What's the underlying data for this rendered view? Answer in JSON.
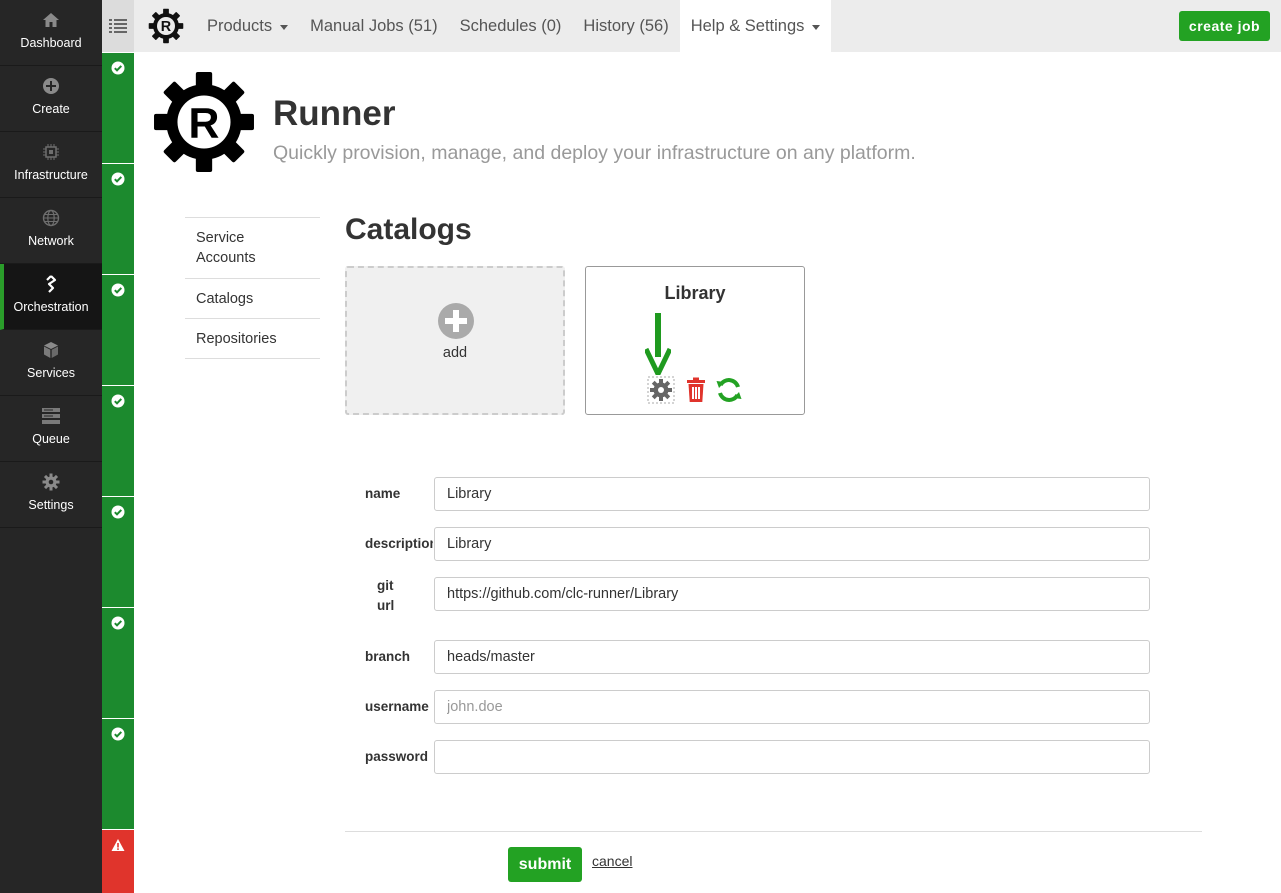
{
  "leftnav": {
    "items": [
      {
        "label": "Dashboard",
        "icon": "home-icon"
      },
      {
        "label": "Create",
        "icon": "plus-circle-icon"
      },
      {
        "label": "Infrastructure",
        "icon": "chip-icon"
      },
      {
        "label": "Network",
        "icon": "globe-icon"
      },
      {
        "label": "Orchestration",
        "icon": "orchestration-icon"
      },
      {
        "label": "Services",
        "icon": "cube-icon"
      },
      {
        "label": "Queue",
        "icon": "queue-icon"
      },
      {
        "label": "Settings",
        "icon": "gear-icon"
      }
    ],
    "active": "Orchestration"
  },
  "status": {
    "colors": {
      "ok": "#1c8a2e",
      "error": "#e0342c"
    },
    "cells": [
      "success",
      "success",
      "success",
      "success",
      "success",
      "success",
      "success",
      "error"
    ]
  },
  "topbar": {
    "menu": [
      {
        "label": "Products",
        "dropdown": true
      },
      {
        "label": "Manual Jobs (51)",
        "dropdown": false
      },
      {
        "label": "Schedules (0)",
        "dropdown": false
      },
      {
        "label": "History (56)",
        "dropdown": false
      },
      {
        "label": "Help & Settings",
        "dropdown": true
      }
    ],
    "create_job": "create job"
  },
  "header": {
    "title": "Runner",
    "subtitle": "Quickly provision, manage, and deploy your infrastructure on any platform."
  },
  "subnav": {
    "items": [
      "Service Accounts",
      "Catalogs",
      "Repositories"
    ]
  },
  "catalogs": {
    "title": "Catalogs",
    "add_label": "add",
    "card_title": "Library",
    "actions": [
      "gear-icon",
      "trash-icon",
      "refresh-icon"
    ],
    "accent": "#23a223"
  },
  "form": {
    "name": {
      "label": "name",
      "value": "Library"
    },
    "description": {
      "label": "description",
      "value": "Library"
    },
    "git_url": {
      "label": "git url",
      "label_line1": "git",
      "label_line2": "url",
      "value": "https://github.com/clc-runner/Library"
    },
    "branch": {
      "label": "branch",
      "value": "heads/master"
    },
    "username": {
      "label": "username",
      "value": "",
      "placeholder": "john.doe"
    },
    "password": {
      "label": "password",
      "value": ""
    },
    "submit": "submit",
    "cancel": "cancel"
  }
}
